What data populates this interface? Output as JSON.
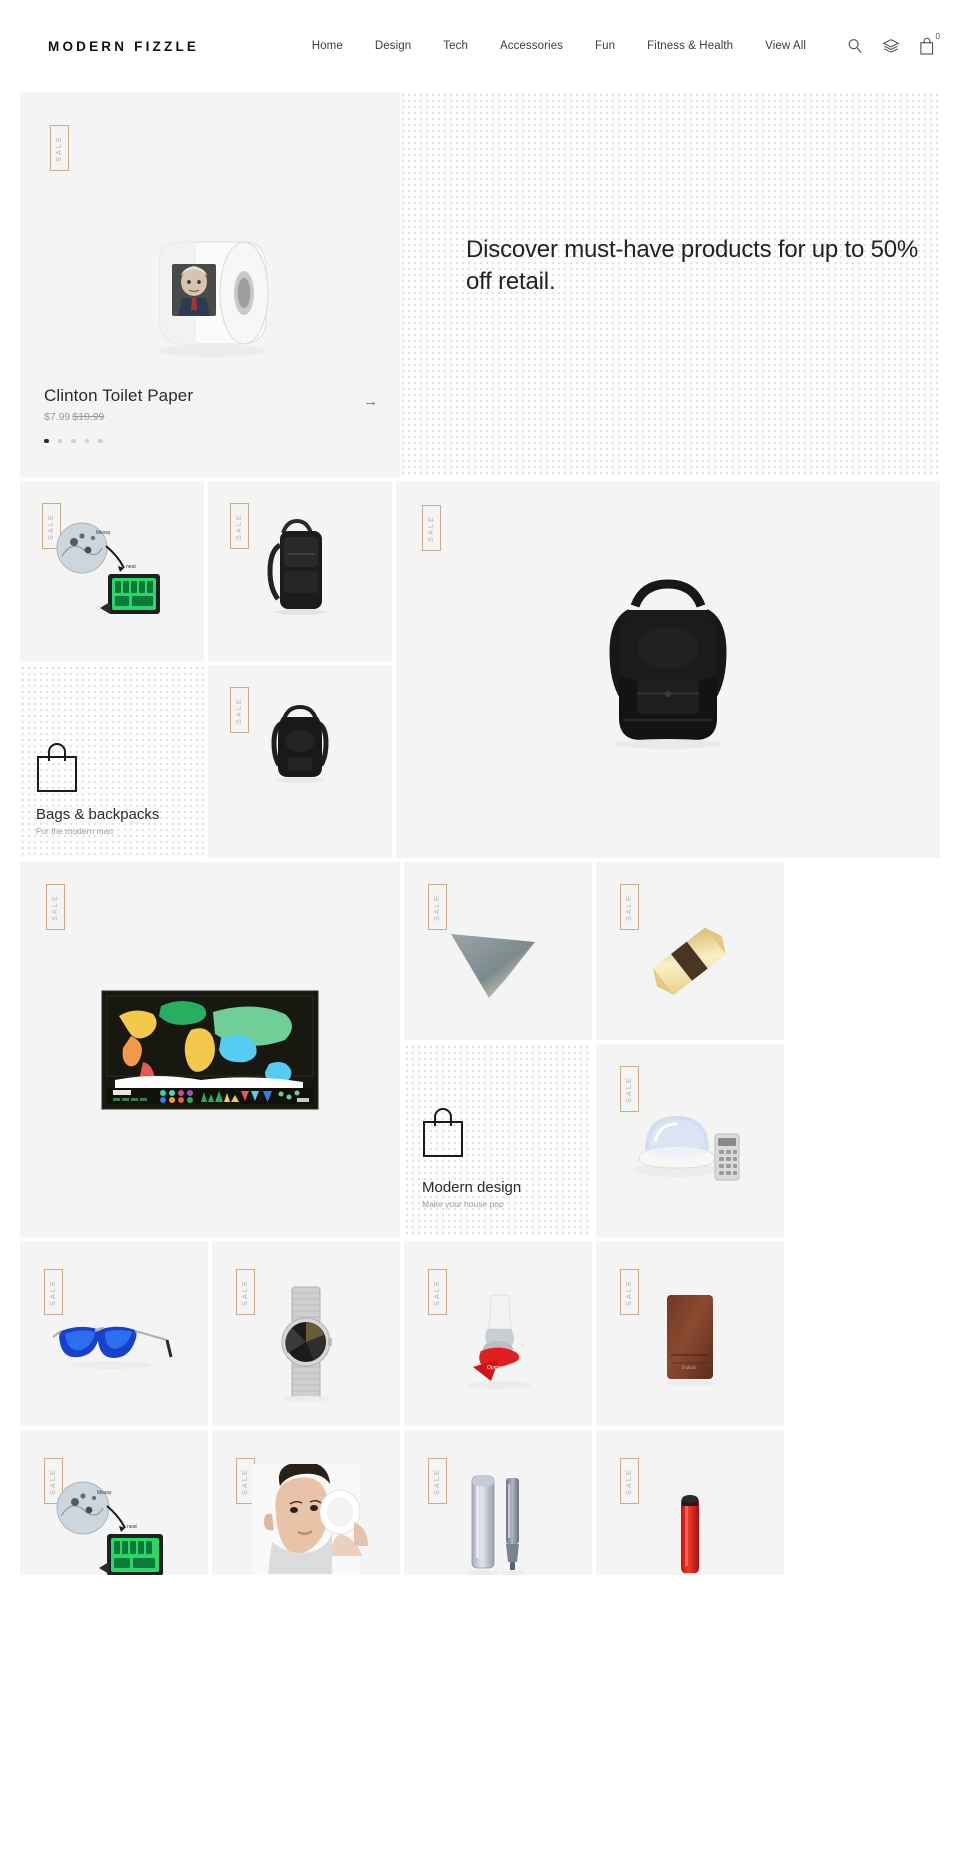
{
  "header": {
    "logo": "MODERN FIZZLE",
    "nav": [
      {
        "label": "Home"
      },
      {
        "label": "Design"
      },
      {
        "label": "Tech"
      },
      {
        "label": "Accessories"
      },
      {
        "label": "Fun"
      },
      {
        "label": "Fitness & Health"
      },
      {
        "label": "View All"
      }
    ],
    "icons": {
      "search": "search-icon",
      "layers": "layers-icon",
      "bag": "shopping-bag-icon"
    },
    "cart_count": "0"
  },
  "hero": {
    "headline": "Discover must-have products for up to 50% off retail.",
    "product_title": "Clinton Toilet Paper",
    "price": "$7.99",
    "compare_price": "$10.99",
    "arrow": "→",
    "dots_total": 5,
    "active_dot": 0
  },
  "badges": {
    "sale": "SALE"
  },
  "promos": [
    {
      "title": "Bags & backpacks",
      "subtitle": "For the modern man",
      "icon": "shopping-bag-icon"
    },
    {
      "title": "Modern design",
      "subtitle": "Make your house pop",
      "icon": "shopping-bag-icon"
    }
  ],
  "products": [
    {
      "name": "travel-organizer-set",
      "badge": "SALE"
    },
    {
      "name": "black-business-backpack",
      "badge": "SALE"
    },
    {
      "name": "black-leather-backpack-large",
      "badge": "SALE"
    },
    {
      "name": "small-black-backpack",
      "badge": "SALE"
    },
    {
      "name": "scratch-off-world-map",
      "badge": "SALE"
    },
    {
      "name": "triangle-wall-lamp",
      "badge": "SALE"
    },
    {
      "name": "gold-diamond-wall-light",
      "badge": "SALE"
    },
    {
      "name": "star-projector-night-light",
      "badge": "SALE"
    },
    {
      "name": "blue-mirror-aviator-sunglasses",
      "badge": "SALE"
    },
    {
      "name": "silver-mesh-wrist-watch",
      "badge": "SALE"
    },
    {
      "name": "red-bottle-opener",
      "badge": "SALE"
    },
    {
      "name": "brown-leather-wallet",
      "badge": "SALE"
    },
    {
      "name": "travel-organizer-set-2",
      "badge": "SALE"
    },
    {
      "name": "facial-cleansing-brush",
      "badge": "SALE"
    },
    {
      "name": "pocket-screwdriver-kit",
      "badge": "SALE"
    },
    {
      "name": "red-lipstick-case",
      "badge": "SALE"
    }
  ],
  "colors": {
    "tile_bg": "#f4f4f4",
    "badge_border": "#c9ad8a",
    "text": "#1a1a1a",
    "muted": "#9a9a9a"
  }
}
